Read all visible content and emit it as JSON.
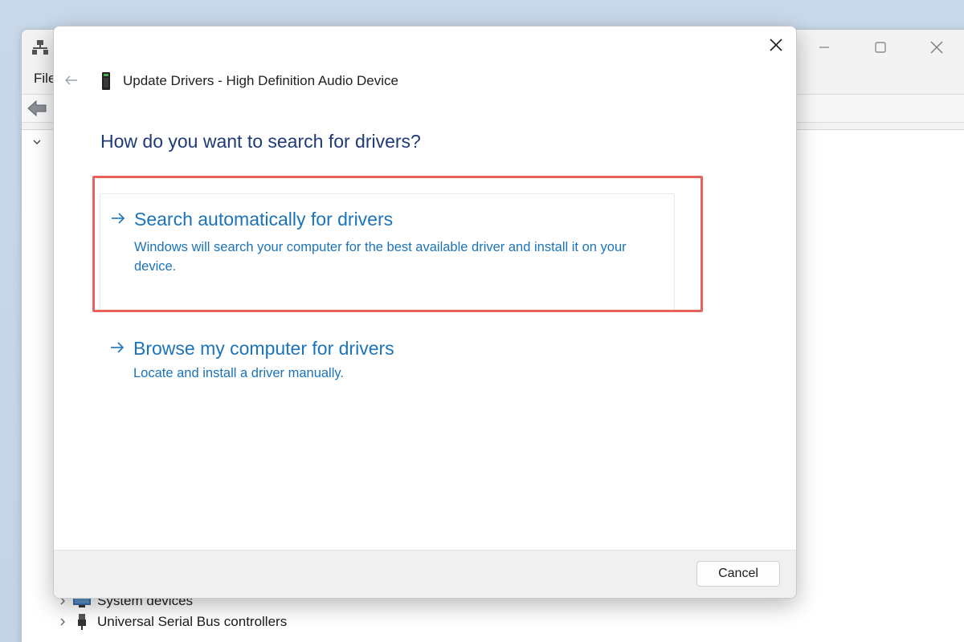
{
  "background_window": {
    "menu": {
      "file_label": "File"
    },
    "tree": {
      "items": [
        {
          "label": "System devices",
          "icon": "system-devices-icon"
        },
        {
          "label": "Universal Serial Bus controllers",
          "icon": "usb-plug-icon"
        }
      ]
    },
    "icons": {
      "app": "device-manager-icon",
      "minimize": "minimize-icon",
      "maximize": "maximize-icon",
      "close": "close-icon",
      "back": "back-arrow-icon"
    }
  },
  "dialog": {
    "title": "Update Drivers - High Definition Audio Device",
    "question": "How do you want to search for drivers?",
    "options": [
      {
        "title": "Search automatically for drivers",
        "description": "Windows will search your computer for the best available driver and install it on your device."
      },
      {
        "title": "Browse my computer for drivers",
        "description": "Locate and install a driver manually."
      }
    ],
    "cancel_label": "Cancel",
    "icons": {
      "close": "close-icon",
      "back": "back-arrow-icon",
      "device": "audio-device-icon",
      "option_arrow": "right-arrow-icon"
    }
  },
  "colors": {
    "link_blue": "#1b73b9",
    "heading_blue": "#1e3a78",
    "highlight_red": "#e8625c",
    "desktop_bg": "#c9d9ea"
  }
}
